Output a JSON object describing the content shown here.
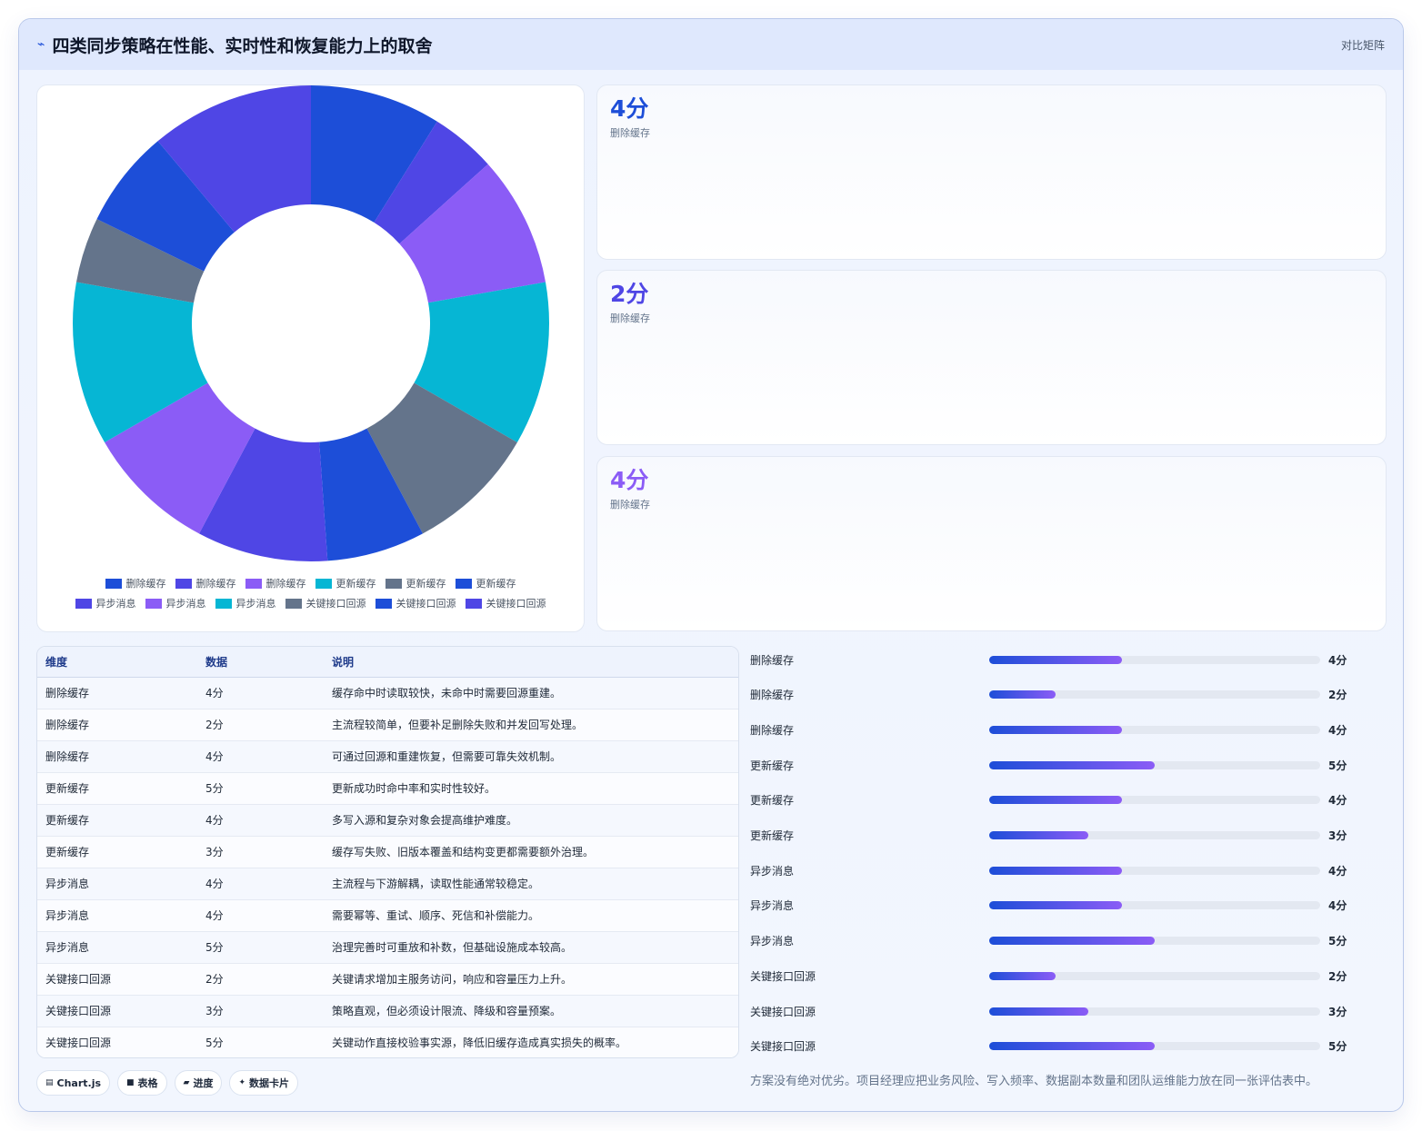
{
  "header": {
    "title": "四类同步策略在性能、实时性和恢复能力上的取舍",
    "tag": "对比矩阵",
    "icon": "pulse-icon"
  },
  "chart_data": {
    "type": "pie",
    "categories": [
      "删除缓存",
      "删除缓存",
      "删除缓存",
      "更新缓存",
      "更新缓存",
      "更新缓存",
      "异步消息",
      "异步消息",
      "异步消息",
      "关键接口回源",
      "关键接口回源",
      "关键接口回源"
    ],
    "values": [
      4,
      2,
      4,
      5,
      4,
      3,
      4,
      4,
      5,
      2,
      3,
      5
    ],
    "colors": [
      "#1d4ed8",
      "#4f46e5",
      "#8b5cf6",
      "#06b6d4",
      "#64748b",
      "#1d4ed8",
      "#4f46e5",
      "#8b5cf6",
      "#06b6d4",
      "#64748b",
      "#1d4ed8",
      "#4f46e5"
    ],
    "legend_position": "bottom",
    "donut": true
  },
  "kpis": [
    {
      "value": "4分",
      "label": "删除缓存",
      "color": "#1d4ed8"
    },
    {
      "value": "2分",
      "label": "删除缓存",
      "color": "#4f46e5"
    },
    {
      "value": "4分",
      "label": "删除缓存",
      "color": "#8b5cf6"
    }
  ],
  "table": {
    "headers": [
      "维度",
      "数据",
      "说明"
    ],
    "rows": [
      [
        "删除缓存",
        "4分",
        "缓存命中时读取较快，未命中时需要回源重建。"
      ],
      [
        "删除缓存",
        "2分",
        "主流程较简单，但要补足删除失败和并发回写处理。"
      ],
      [
        "删除缓存",
        "4分",
        "可通过回源和重建恢复，但需要可靠失效机制。"
      ],
      [
        "更新缓存",
        "5分",
        "更新成功时命中率和实时性较好。"
      ],
      [
        "更新缓存",
        "4分",
        "多写入源和复杂对象会提高维护难度。"
      ],
      [
        "更新缓存",
        "3分",
        "缓存写失败、旧版本覆盖和结构变更都需要额外治理。"
      ],
      [
        "异步消息",
        "4分",
        "主流程与下游解耦，读取性能通常较稳定。"
      ],
      [
        "异步消息",
        "4分",
        "需要幂等、重试、顺序、死信和补偿能力。"
      ],
      [
        "异步消息",
        "5分",
        "治理完善时可重放和补数，但基础设施成本较高。"
      ],
      [
        "关键接口回源",
        "2分",
        "关键请求增加主服务访问，响应和容量压力上升。"
      ],
      [
        "关键接口回源",
        "3分",
        "策略直观，但必须设计限流、降级和容量预案。"
      ],
      [
        "关键接口回源",
        "5分",
        "关键动作直接校验事实源，降低旧缓存造成真实损失的概率。"
      ]
    ]
  },
  "bars": {
    "max": 10,
    "items": [
      {
        "label": "删除缓存",
        "value": 4,
        "text": "4分"
      },
      {
        "label": "删除缓存",
        "value": 2,
        "text": "2分"
      },
      {
        "label": "删除缓存",
        "value": 4,
        "text": "4分"
      },
      {
        "label": "更新缓存",
        "value": 5,
        "text": "5分"
      },
      {
        "label": "更新缓存",
        "value": 4,
        "text": "4分"
      },
      {
        "label": "更新缓存",
        "value": 3,
        "text": "3分"
      },
      {
        "label": "异步消息",
        "value": 4,
        "text": "4分"
      },
      {
        "label": "异步消息",
        "value": 4,
        "text": "4分"
      },
      {
        "label": "异步消息",
        "value": 5,
        "text": "5分"
      },
      {
        "label": "关键接口回源",
        "value": 2,
        "text": "2分"
      },
      {
        "label": "关键接口回源",
        "value": 3,
        "text": "3分"
      },
      {
        "label": "关键接口回源",
        "value": 5,
        "text": "5分"
      }
    ]
  },
  "chips": [
    {
      "icon": "chart-icon",
      "glyph": "▤",
      "label": "Chart.js"
    },
    {
      "icon": "table-icon",
      "glyph": "■",
      "label": "表格"
    },
    {
      "icon": "progress-icon",
      "glyph": "▰",
      "label": "进度"
    },
    {
      "icon": "card-icon",
      "glyph": "✦",
      "label": "数据卡片"
    }
  ],
  "footnote": "方案没有绝对优劣。项目经理应把业务风险、写入频率、数据副本数量和团队运维能力放在同一张评估表中。"
}
